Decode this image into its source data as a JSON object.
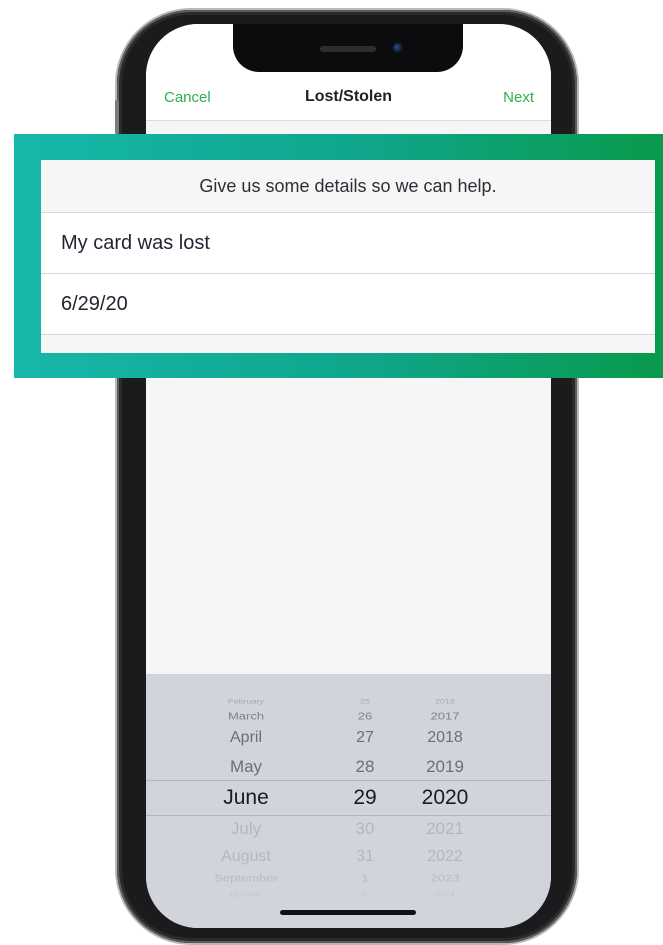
{
  "nav": {
    "cancel": "Cancel",
    "title": "Lost/Stolen",
    "next": "Next"
  },
  "form": {
    "header": "Give us some details so we can help.",
    "reason_value": "My card was lost",
    "date_value": "6/29/20"
  },
  "picker": {
    "months": [
      "February",
      "March",
      "April",
      "May",
      "June",
      "July",
      "August",
      "September",
      "October"
    ],
    "days": [
      "25",
      "26",
      "27",
      "28",
      "29",
      "30",
      "31",
      "1",
      "2"
    ],
    "years": [
      "2016",
      "2017",
      "2018",
      "2019",
      "2020",
      "2021",
      "2022",
      "2023",
      "2024"
    ],
    "selected_index": 4
  },
  "colors": {
    "accent": "#2fae52",
    "highlight_start": "#17b7aa",
    "highlight_end": "#0a9a4c"
  }
}
